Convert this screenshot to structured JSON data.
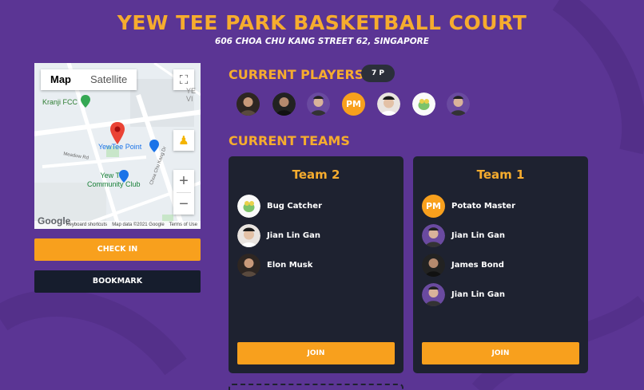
{
  "court": {
    "title": "YEW TEE PARK BASKETBALL COURT",
    "address": "606 CHOA CHU KANG STREET 62, SINGAPORE"
  },
  "map": {
    "toggle": {
      "map_label": "Map",
      "satellite_label": "Satellite"
    },
    "labels": {
      "kranji": "Kranji FCC",
      "yewtee_point": "YewTee Point",
      "community_club_line1": "Yew Tee",
      "community_club_line2": "Community Club",
      "meadow": "Meadow Rd",
      "choa_chu_kang": "Choa Chu Kang Dr",
      "partial": "YE\nVI"
    },
    "zoom_in": "+",
    "zoom_out": "−",
    "footer": {
      "shortcuts": "Keyboard shortcuts",
      "copyright": "Map data ©2021 Google",
      "terms": "Terms of Use"
    },
    "logo": "Google"
  },
  "actions": {
    "check_in": "CHECK IN",
    "bookmark": "BOOKMARK"
  },
  "players": {
    "title": "CURRENT PLAYERS",
    "count": "7 P",
    "initials_avatar": "PM"
  },
  "teams": {
    "title": "CURRENT TEAMS",
    "list": [
      {
        "name": "Team 2",
        "members": [
          "Bug Catcher",
          "Jian Lin Gan",
          "Elon Musk"
        ],
        "join": "JOIN"
      },
      {
        "name": "Team 1",
        "members": [
          "Potato Master",
          "Jian Lin Gan",
          "James Bond",
          "Jian Lin Gan"
        ],
        "member_initials": "PM",
        "join": "JOIN"
      }
    ]
  },
  "colors": {
    "background": "#5b3594",
    "accent": "#f6ac2e",
    "button": "#f8a01d",
    "card": "#1e2230",
    "dark_button": "#161d2d"
  }
}
